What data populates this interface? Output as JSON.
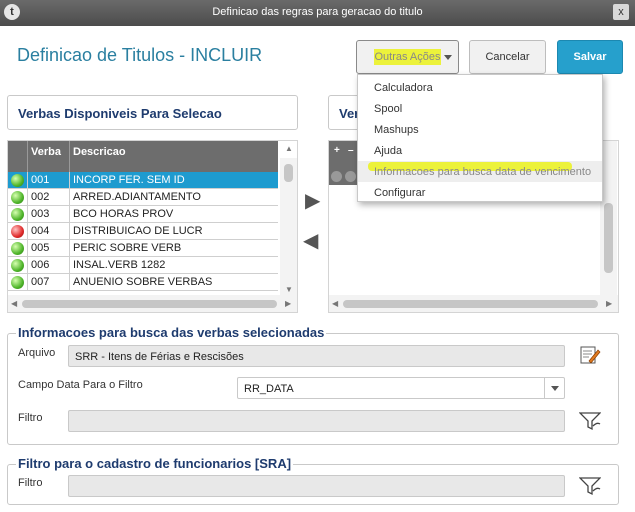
{
  "window": {
    "title": "Definicao das regras para geracao do titulo",
    "logo": "t",
    "close_label": "x"
  },
  "page": {
    "title": "Definicao de Titulos - INCLUIR"
  },
  "toolbar": {
    "outras_acoes": "Outras Ações",
    "cancelar": "Cancelar",
    "salvar": "Salvar"
  },
  "menu": {
    "items": [
      {
        "label": "Calculadora"
      },
      {
        "label": "Spool"
      },
      {
        "label": "Mashups"
      },
      {
        "label": "Ajuda"
      },
      {
        "label": "Informacoes para busca data de vencimento",
        "highlighted": true
      },
      {
        "label": "Configurar"
      }
    ]
  },
  "left_panel": {
    "title": "Verbas Disponiveis Para Selecao",
    "columns": [
      "Verba",
      "Descricao"
    ],
    "rows": [
      {
        "status": "green",
        "verba": "001",
        "descricao": "INCORP FER. SEM ID",
        "selected": true
      },
      {
        "status": "green",
        "verba": "002",
        "descricao": "ARRED.ADIANTAMENTO"
      },
      {
        "status": "green",
        "verba": "003",
        "descricao": "BCO HORAS PROV"
      },
      {
        "status": "red",
        "verba": "004",
        "descricao": "DISTRIBUICAO DE LUCR"
      },
      {
        "status": "green",
        "verba": "005",
        "descricao": "PERIC SOBRE VERB"
      },
      {
        "status": "green",
        "verba": "006",
        "descricao": "INSAL.VERB 1282"
      },
      {
        "status": "green",
        "verba": "007",
        "descricao": "ANUENIO SOBRE VERBAS"
      }
    ]
  },
  "right_panel": {
    "title_partial": "Ver",
    "head_symbols": [
      "+",
      "–"
    ]
  },
  "busca": {
    "legend": "Informacoes para busca das verbas selecionadas",
    "arquivo_label": "Arquivo",
    "arquivo_value": "SRR - Itens de Férias e Rescisões",
    "campo_label": "Campo Data Para o Filtro",
    "campo_value": "RR_DATA",
    "filtro_label": "Filtro",
    "filtro_value": ""
  },
  "sra": {
    "legend": "Filtro para o cadastro de funcionarios [SRA]",
    "filtro_label": "Filtro",
    "filtro_value": ""
  },
  "colors": {
    "accent": "#26a0cc",
    "title": "#2a7fa0",
    "selected_row": "#1e9bcf",
    "highlight": "#ecf23b"
  }
}
